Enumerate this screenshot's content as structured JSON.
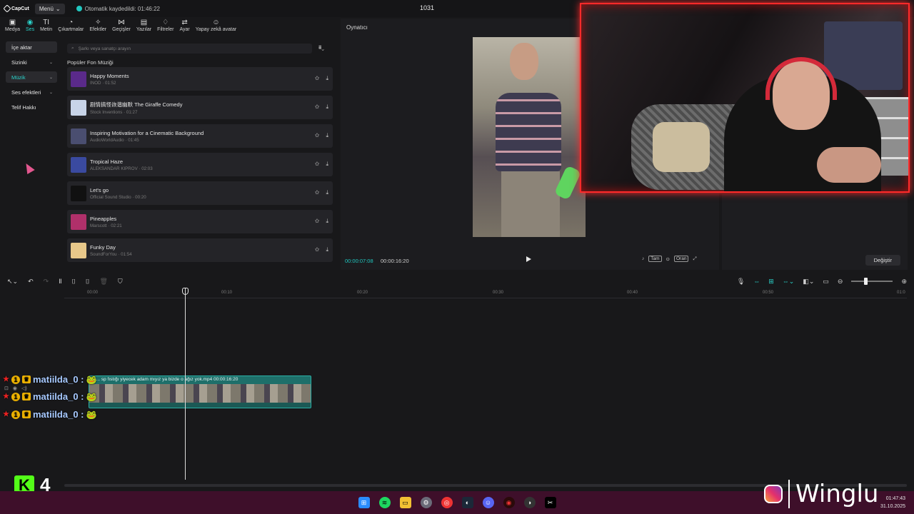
{
  "titlebar": {
    "app_name": "CapCut",
    "menu_label": "Menü",
    "autosave_text": "Otomatik kaydedildi: 01:46:22",
    "project_title": "1031"
  },
  "toolbar": {
    "tabs": [
      {
        "label": "Medya",
        "icon": "media-icon",
        "glyph": "▣"
      },
      {
        "label": "Ses",
        "icon": "audio-icon",
        "glyph": "◉"
      },
      {
        "label": "Metin",
        "icon": "text-icon",
        "glyph": "TI"
      },
      {
        "label": "Çıkartmalar",
        "icon": "sticker-icon",
        "glyph": "◔"
      },
      {
        "label": "Efektler",
        "icon": "effects-icon",
        "glyph": "✧"
      },
      {
        "label": "Geçişler",
        "icon": "transitions-icon",
        "glyph": "⋈"
      },
      {
        "label": "Yazılar",
        "icon": "captions-icon",
        "glyph": "▤"
      },
      {
        "label": "Filtreler",
        "icon": "filters-icon",
        "glyph": "♢"
      },
      {
        "label": "Ayar",
        "icon": "adjust-icon",
        "glyph": "⇄"
      },
      {
        "label": "Yapay zekâ avatar",
        "icon": "ai-avatar-icon",
        "glyph": "☺"
      }
    ]
  },
  "sidebar": {
    "items": [
      {
        "label": "İçe aktar",
        "chevron": ""
      },
      {
        "label": "Sizinki",
        "chevron": "⌄"
      },
      {
        "label": "Müzik",
        "chevron": "⌄"
      },
      {
        "label": "Ses efektleri",
        "chevron": "⌄"
      },
      {
        "label": "Telif Hakkı",
        "chevron": ""
      }
    ]
  },
  "music": {
    "search_placeholder": "Şarkı veya sanatçı arayın",
    "section_title": "Popüler Fon Müziği",
    "tracks": [
      {
        "name": "Happy Moments",
        "meta": "INOD · 01:52",
        "thumb_color": "#5a2a8a"
      },
      {
        "name": "剧情搞怪诙谐幽默  The Giraffe Comedy",
        "meta": "Stock Inventions · 01:27",
        "thumb_color": "#c8d4e8"
      },
      {
        "name": "Inspiring Motivation for a Cinematic Background",
        "meta": "AudioWorldAudio · 01:45",
        "thumb_color": "#4a4e70"
      },
      {
        "name": "Tropical Haze",
        "meta": "ALEKSANDAR KIPROV · 02:03",
        "thumb_color": "#3a4aa0"
      },
      {
        "name": "Let's go",
        "meta": "Official Sound Studio · 00:20",
        "thumb_color": "#111111"
      },
      {
        "name": "Pineapples",
        "meta": "Marscott · 02:21",
        "thumb_color": "#b0306a"
      },
      {
        "name": "Funky Day",
        "meta": "SoundForYou · 01:54",
        "thumb_color": "#e8c88a"
      }
    ]
  },
  "player": {
    "title": "Oynatıcı",
    "current_time": "00:00:07:08",
    "total_time": "00:00:16:20",
    "controls": [
      "Tam",
      "Oran"
    ]
  },
  "details": {
    "change_button": "Değiştir"
  },
  "timeline": {
    "ticks": [
      "00:00",
      "00:10",
      "00:20",
      "00:30",
      "00:40",
      "00:50",
      "01:0"
    ],
    "clip_title": "b... sp fıstığı yiyecek adam mıyız ya bizde o ağız yok.mp4   00:00:16:20"
  },
  "chat": {
    "lines": [
      {
        "user": "matiilda_0 :"
      },
      {
        "user": "matiilda_0 :"
      },
      {
        "user": "matiilda_0 :"
      }
    ]
  },
  "overlay": {
    "kick_letter": "K",
    "kick_number": "4",
    "instagram_name": "Winglu"
  },
  "taskbar": {
    "time": "01:47:43",
    "date": "31.10.2025"
  }
}
